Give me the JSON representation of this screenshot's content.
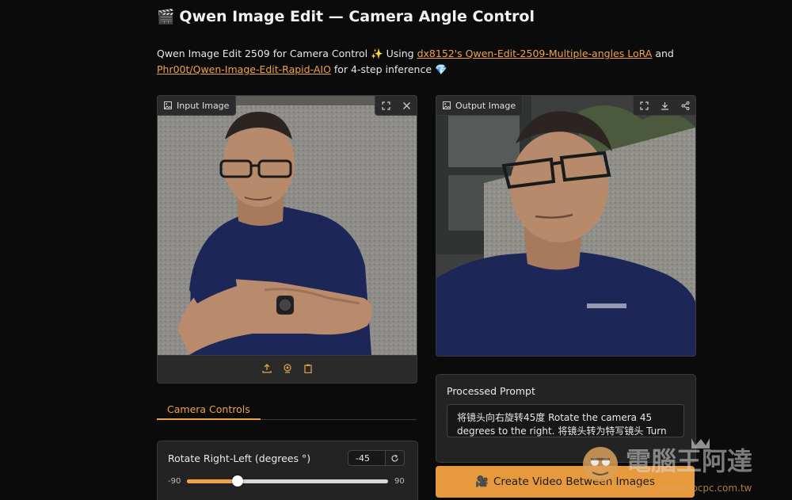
{
  "header": {
    "title_emoji": "🎬",
    "title": "Qwen Image Edit — Camera Angle Control"
  },
  "description": {
    "prefix": "Qwen Image Edit 2509 for Camera Control ✨ Using ",
    "link1": "dx8152's Qwen-Edit-2509-Multiple-angles LoRA",
    "mid": " and ",
    "link2": "Phr00t/Qwen-Image-Edit-Rapid-AIO",
    "suffix": " for 4-step inference 💎"
  },
  "input_panel": {
    "label": "Input Image",
    "tools": [
      "fullscreen-icon",
      "close-icon"
    ],
    "bottom_actions": [
      "upload-icon",
      "webcam-icon",
      "clipboard-icon"
    ]
  },
  "output_panel": {
    "label": "Output Image",
    "tools": [
      "fullscreen-icon",
      "download-icon",
      "share-icon"
    ]
  },
  "tabs": {
    "active": "Camera Controls"
  },
  "controls": {
    "rotate": {
      "label": "Rotate Right-Left (degrees °)",
      "value": "-45",
      "min": "-90",
      "max": "90",
      "min_num": -90,
      "max_num": 90,
      "current_num": -45
    }
  },
  "processed_prompt": {
    "title": "Processed Prompt",
    "text": "将镜头向右旋转45度 Rotate the camera 45 degrees to the right. 将镜头转为特写镜头 Turn the"
  },
  "cta": {
    "emoji": "🎥",
    "label": "Create Video Between Images"
  },
  "watermark": {
    "name": "電腦王阿達",
    "url": "http://www.kocpc.com.tw"
  },
  "colors": {
    "accent": "#f0a24a",
    "button": "#e79a3d",
    "background": "#0b0b0b",
    "panel": "#232323"
  }
}
